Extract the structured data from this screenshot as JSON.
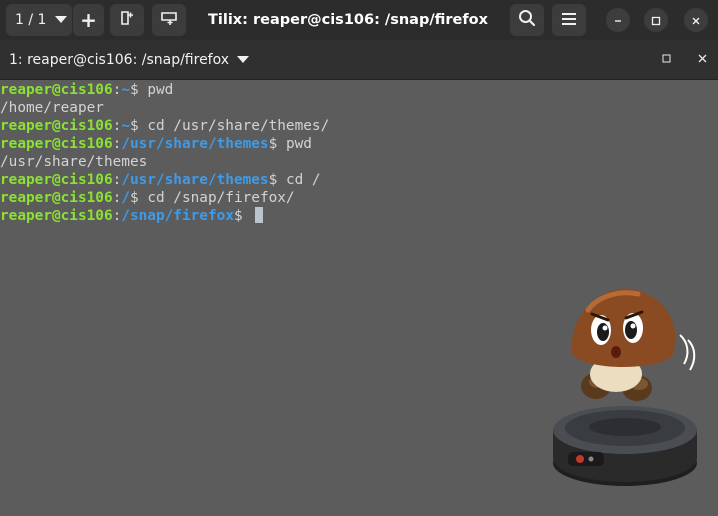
{
  "header": {
    "session_label": "1 / 1",
    "title": "Tilix: reaper@cis106: /snap/firefox",
    "icons": {
      "session_dropdown": "chevron-down-icon",
      "add_session": "plus-icon",
      "split_vertical": "split-right-icon",
      "split_horizontal": "split-down-icon",
      "search": "search-icon",
      "menu": "hamburger-menu-icon",
      "minimize": "minimize-icon",
      "maximize": "maximize-icon",
      "close": "close-icon"
    }
  },
  "terminal_bar": {
    "title": "1: reaper@cis106: /snap/firefox"
  },
  "terminal": {
    "lines": [
      {
        "user": "reaper@cis106",
        "sep": ":",
        "path": "~",
        "prompt": "$ ",
        "cmd": "pwd"
      },
      {
        "output": "/home/reaper"
      },
      {
        "user": "reaper@cis106",
        "sep": ":",
        "path": "~",
        "prompt": "$ ",
        "cmd": "cd /usr/share/themes/"
      },
      {
        "user": "reaper@cis106",
        "sep": ":",
        "path": "/usr/share/themes",
        "prompt": "$ ",
        "cmd": "pwd"
      },
      {
        "output": "/usr/share/themes"
      },
      {
        "user": "reaper@cis106",
        "sep": ":",
        "path": "/usr/share/themes",
        "prompt": "$ ",
        "cmd": "cd /"
      },
      {
        "user": "reaper@cis106",
        "sep": ":",
        "path": "/",
        "prompt": "$ ",
        "cmd": "cd /snap/firefox/"
      },
      {
        "user": "reaper@cis106",
        "sep": ":",
        "path": "/snap/firefox",
        "prompt": "$ ",
        "cmd": ""
      }
    ]
  },
  "colors": {
    "user": "#8ae234",
    "path": "#3d9be9",
    "text": "#d3d3d3",
    "background": "#5c5c5c",
    "headerbar": "#2c2c2c"
  }
}
